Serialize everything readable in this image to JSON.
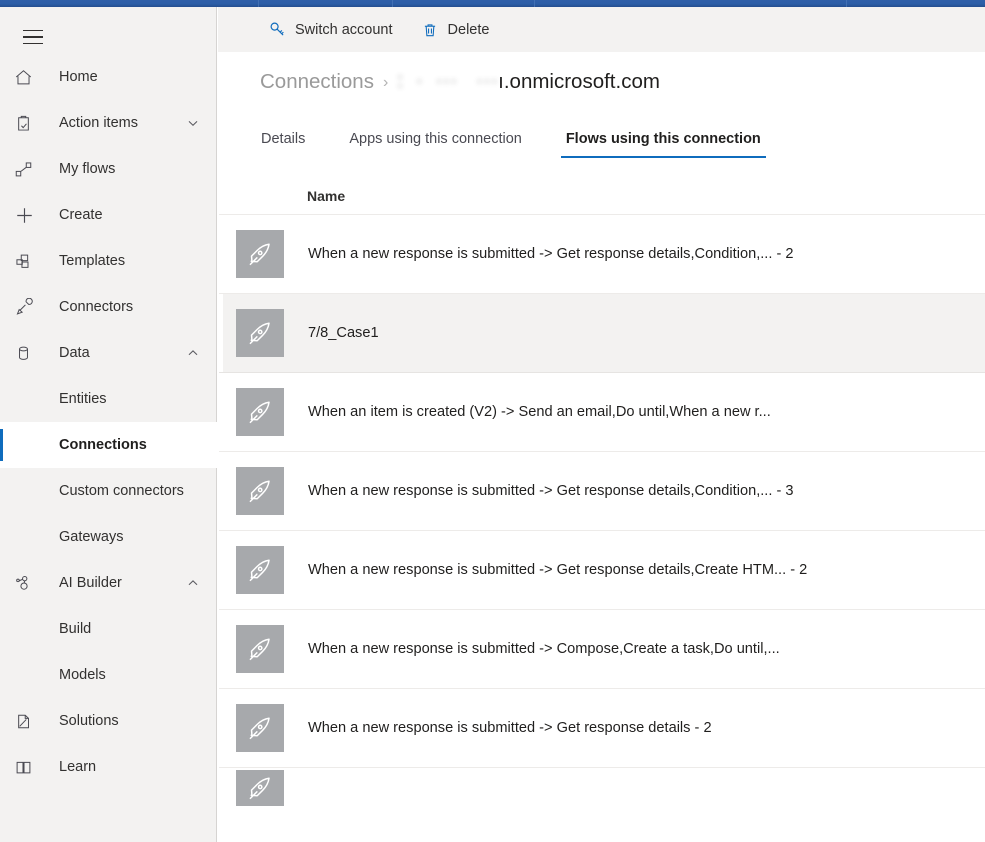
{
  "theme": {
    "accent": "#0f6cbd",
    "chrome_blue": "#2c5ea7",
    "sidebar_bg": "#f3f2f1",
    "content_bg": "#ffffff",
    "row_highlight": "#f3f2f1",
    "divider": "#edebe9",
    "flow_icon_bg": "#a7a9ac",
    "text_primary": "#201f1e",
    "text_secondary": "#9a9a9a"
  },
  "sidebar": {
    "menu_toggle_name": "hamburger-menu",
    "items": [
      {
        "label": "Home",
        "icon": "home-icon",
        "level": "top",
        "chevron": "",
        "selected": false
      },
      {
        "label": "Action items",
        "icon": "clipboard-check-icon",
        "level": "top",
        "chevron": "down",
        "selected": false
      },
      {
        "label": "My flows",
        "icon": "flow-icon",
        "level": "top",
        "chevron": "",
        "selected": false
      },
      {
        "label": "Create",
        "icon": "plus-icon",
        "level": "top",
        "chevron": "",
        "selected": false
      },
      {
        "label": "Templates",
        "icon": "templates-icon",
        "level": "top",
        "chevron": "",
        "selected": false
      },
      {
        "label": "Connectors",
        "icon": "plug-icon",
        "level": "top",
        "chevron": "",
        "selected": false
      },
      {
        "label": "Data",
        "icon": "database-icon",
        "level": "top",
        "chevron": "up",
        "selected": false
      },
      {
        "label": "Entities",
        "icon": "",
        "level": "sub",
        "chevron": "",
        "selected": false
      },
      {
        "label": "Connections",
        "icon": "",
        "level": "sub",
        "chevron": "",
        "selected": true
      },
      {
        "label": "Custom connectors",
        "icon": "",
        "level": "sub",
        "chevron": "",
        "selected": false
      },
      {
        "label": "Gateways",
        "icon": "",
        "level": "sub",
        "chevron": "",
        "selected": false
      },
      {
        "label": "AI Builder",
        "icon": "ai-builder-icon",
        "level": "top",
        "chevron": "up",
        "selected": false
      },
      {
        "label": "Build",
        "icon": "",
        "level": "sub",
        "chevron": "",
        "selected": false
      },
      {
        "label": "Models",
        "icon": "",
        "level": "sub",
        "chevron": "",
        "selected": false
      },
      {
        "label": "Solutions",
        "icon": "solutions-icon",
        "level": "top",
        "chevron": "",
        "selected": false
      },
      {
        "label": "Learn",
        "icon": "book-icon",
        "level": "top",
        "chevron": "",
        "selected": false
      }
    ]
  },
  "command_bar": {
    "buttons": [
      {
        "label": "Switch account",
        "icon": "key-icon",
        "name": "switch-account-button"
      },
      {
        "label": "Delete",
        "icon": "trash-icon",
        "name": "delete-button"
      }
    ]
  },
  "breadcrumb": {
    "parent": "Connections",
    "separator": "›",
    "current_redacted_prefix": ":  ·  ···   ···",
    "current_visible_suffix": "ı.onmicrosoft.com"
  },
  "tabs": [
    {
      "label": "Details",
      "active": false
    },
    {
      "label": "Apps using this connection",
      "active": false
    },
    {
      "label": "Flows using this connection",
      "active": true
    }
  ],
  "flows_table": {
    "columns": [
      "Name"
    ],
    "rows": [
      {
        "name": "When a new response is submitted -> Get response details,Condition,... - 2",
        "icon": "rocket-icon",
        "highlight": false
      },
      {
        "name": "7/8_Case1",
        "icon": "rocket-icon",
        "highlight": true
      },
      {
        "name": "When an item is created (V2) -> Send an email,Do until,When a new r...",
        "icon": "rocket-icon",
        "highlight": false
      },
      {
        "name": "When a new response is submitted -> Get response details,Condition,... - 3",
        "icon": "rocket-icon",
        "highlight": false
      },
      {
        "name": "When a new response is submitted -> Get response details,Create HTM... - 2",
        "icon": "rocket-icon",
        "highlight": false
      },
      {
        "name": "When a new response is submitted -> Compose,Create a task,Do until,...",
        "icon": "rocket-icon",
        "highlight": false
      },
      {
        "name": "When a new response is submitted -> Get response details - 2",
        "icon": "rocket-icon",
        "highlight": false
      },
      {
        "name": "",
        "icon": "rocket-icon",
        "highlight": false
      }
    ]
  }
}
